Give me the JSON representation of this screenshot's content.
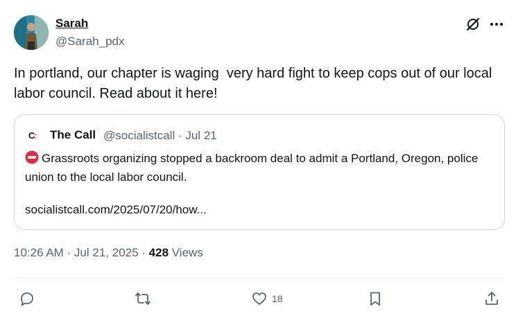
{
  "author": {
    "display_name": "Sarah",
    "handle": "@Sarah_pdx"
  },
  "tweet": {
    "text": "In portland, our chapter is waging  very hard fight to keep cops out of our local labor council. Read about it here!"
  },
  "quote": {
    "logo_text": "C",
    "name": "The Call",
    "meta": "@socialistcall · Jul 21",
    "body": "Grassroots organizing stopped a backroom deal to admit a Portland, Oregon, police union to the local labor council.",
    "link": "socialistcall.com/2025/07/20/how..."
  },
  "footer": {
    "timestamp": "10:26 AM · Jul 21, 2025 · ",
    "views_count": "428",
    "views_label": " Views"
  },
  "actions": {
    "like_count": "18"
  },
  "icons": {
    "grok": "grok-icon",
    "more": "more-icon",
    "reply": "reply-icon",
    "retweet": "retweet-icon",
    "like": "heart-icon",
    "bookmark": "bookmark-icon",
    "share": "share-icon",
    "no_entry": "no-entry-icon"
  },
  "colors": {
    "text_primary": "#0f1419",
    "text_secondary": "#536471",
    "border": "#cfd9de",
    "no_entry_red": "#dd2e44"
  }
}
